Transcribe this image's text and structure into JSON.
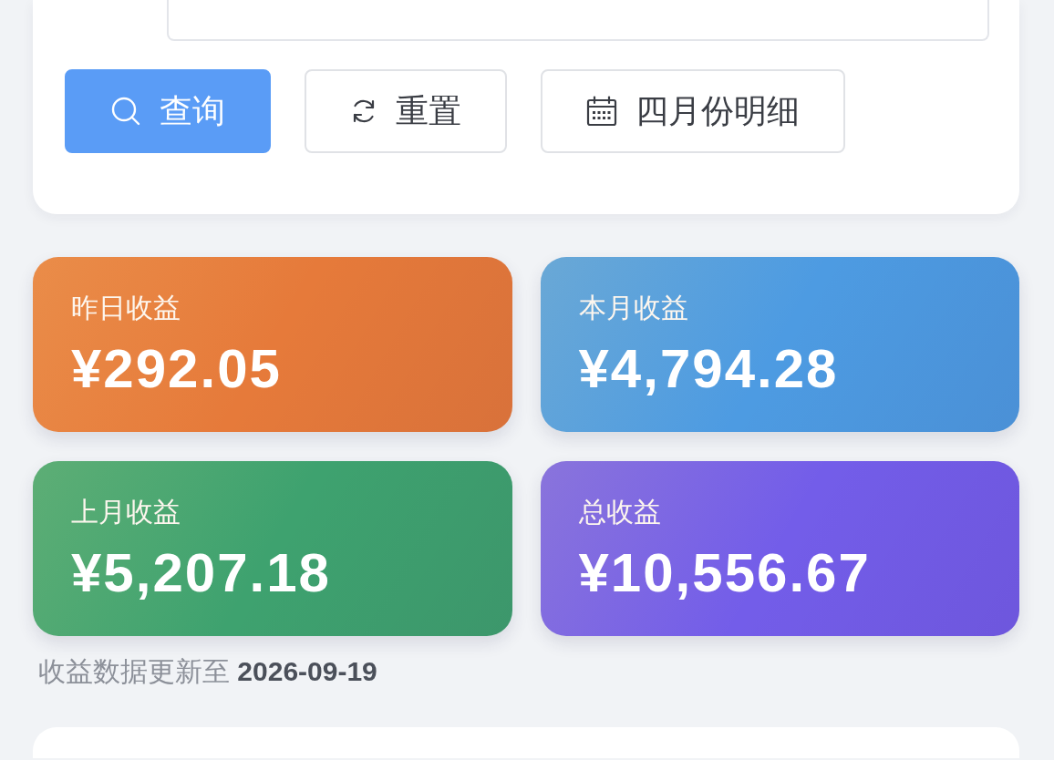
{
  "filter": {
    "buttons": [
      {
        "label": "查询",
        "kind": "query"
      },
      {
        "label": "重置",
        "kind": "reset"
      },
      {
        "label": "四月份明细",
        "kind": "detail"
      }
    ]
  },
  "stats": [
    {
      "label": "昨日收益",
      "value": "¥292.05",
      "color": "#e67a3a"
    },
    {
      "label": "本月收益",
      "value": "¥4,794.28",
      "color": "#4d9be2"
    },
    {
      "label": "上月收益",
      "value": "¥5,207.18",
      "color": "#3ea26f"
    },
    {
      "label": "总收益",
      "value": "¥10,556.67",
      "color": "#735de9"
    }
  ],
  "update_note": "收益数据更新至 **2026-09-19**"
}
